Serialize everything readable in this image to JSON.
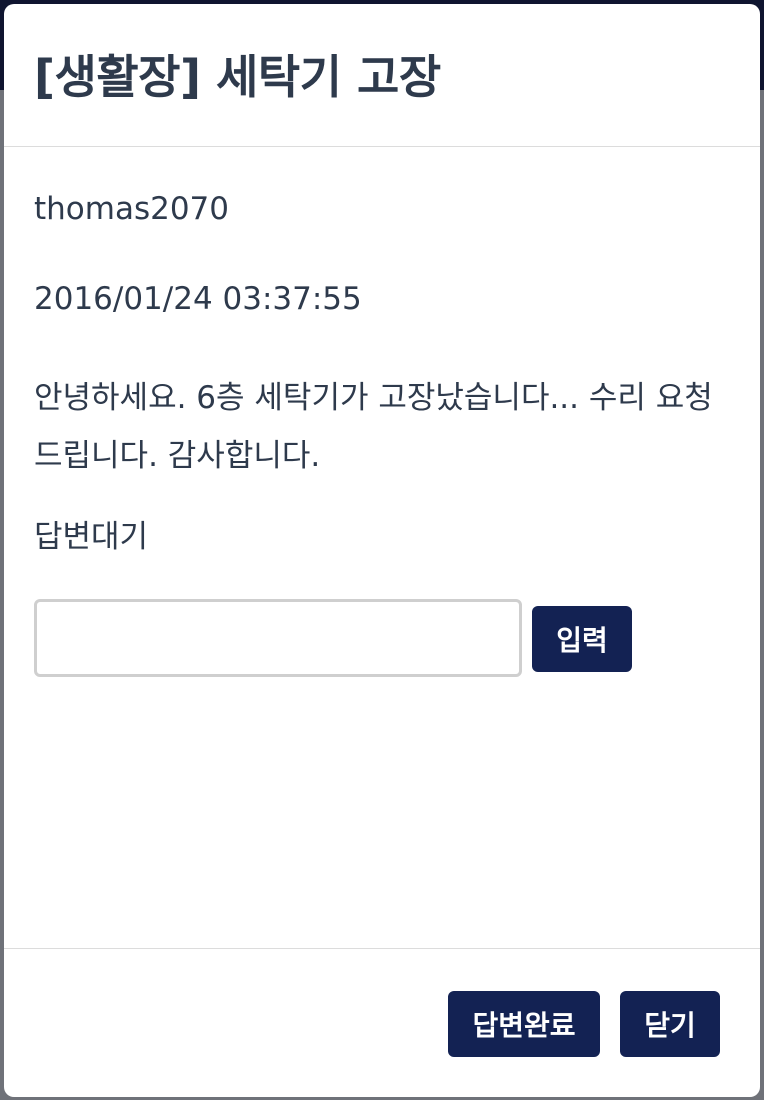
{
  "modal": {
    "title": "[생활장] 세탁기 고장",
    "author": "thomas2070",
    "datetime": "2016/01/24 03:37:55",
    "content": "안녕하세요. 6층 세탁기가 고장났습니다... 수리 요청드립니다. 감사합니다.",
    "status": "답변대기",
    "reply_input": {
      "value": "",
      "placeholder": ""
    },
    "submit_label": "입력",
    "complete_label": "답변완료",
    "close_label": "닫기"
  },
  "colors": {
    "primary_button": "#132253",
    "title_text": "#2e3a4c",
    "backdrop": "#6f7279"
  }
}
